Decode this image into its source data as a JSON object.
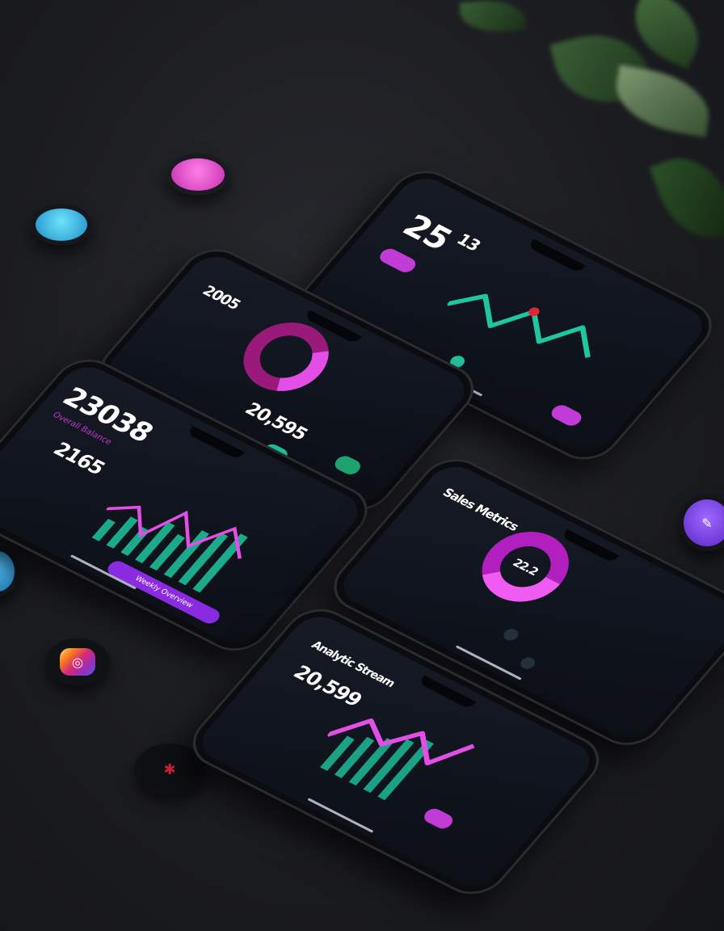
{
  "scene": {
    "description_free": true
  },
  "phones": {
    "p1": {
      "value": "23038",
      "subtitle": "Overall Balance",
      "value2": "2165",
      "chip": "Weekly Overview"
    },
    "p2": {
      "value": "20,595",
      "header": "2005"
    },
    "p3": {
      "value": "25",
      "suffix": "13"
    },
    "p4": {
      "title": "Sales Metrics",
      "center_value": "22.2"
    },
    "p5": {
      "header": "Analytic Stream",
      "value": "20,599"
    }
  },
  "badges": [
    {
      "name": "pink-app",
      "color": "#e040c8"
    },
    {
      "name": "cyan-app",
      "color": "#26b3e6"
    },
    {
      "name": "instagram",
      "color": "#c13584"
    },
    {
      "name": "red-app",
      "color": "#e0263b"
    },
    {
      "name": "purple-app",
      "color": "#7b3ff2"
    },
    {
      "name": "blue-app",
      "color": "#2fa0d8"
    }
  ],
  "colors": {
    "accent_magenta": "#d63be6",
    "accent_teal": "#1fc6a0",
    "accent_purple": "#8a2be2"
  }
}
